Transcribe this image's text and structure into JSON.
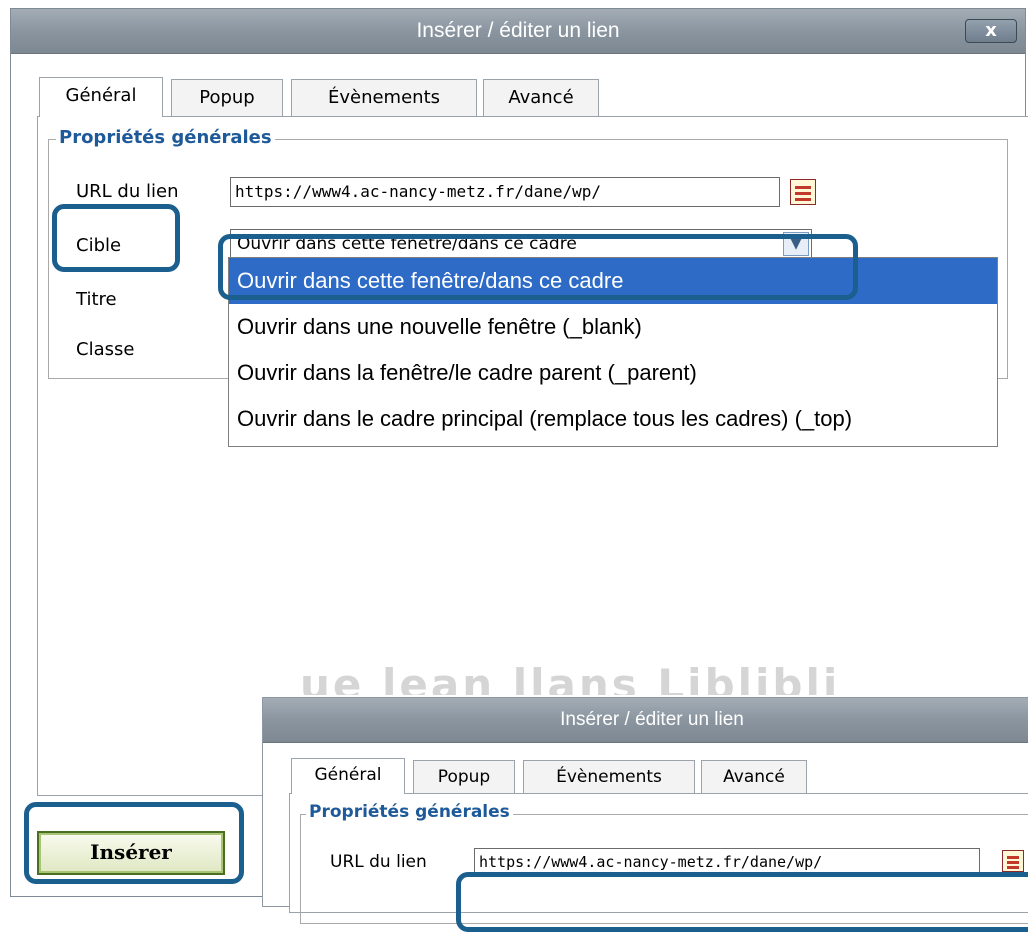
{
  "main_dialog": {
    "title": "Insérer / éditer un lien",
    "close_label": "x",
    "tabs": [
      "Général",
      "Popup",
      "Évènements",
      "Avancé"
    ],
    "legend": "Propriétés générales",
    "fields": {
      "url_label": "URL du lien",
      "url_value": "https://www4.ac-nancy-metz.fr/dane/wp/",
      "target_label": "Cible",
      "target_value": "Ouvrir dans cette fenêtre/dans ce cadre",
      "title_label": "Titre",
      "class_label": "Classe"
    },
    "target_options": [
      "Ouvrir dans cette fenêtre/dans ce cadre",
      "Ouvrir dans une nouvelle fenêtre (_blank)",
      "Ouvrir dans la fenêtre/le cadre parent (_parent)",
      "Ouvrir dans le cadre principal (remplace tous les cadres) (_top)"
    ],
    "insert_label": "Insérer"
  },
  "second_dialog": {
    "title": "Insérer / éditer un lien",
    "tabs": [
      "Général",
      "Popup",
      "Évènements",
      "Avancé"
    ],
    "legend": "Propriétés générales",
    "url_label": "URL du lien",
    "url_value": "https://www4.ac-nancy-metz.fr/dane/wp/"
  },
  "background_text": "ue lean llans Liblibli"
}
